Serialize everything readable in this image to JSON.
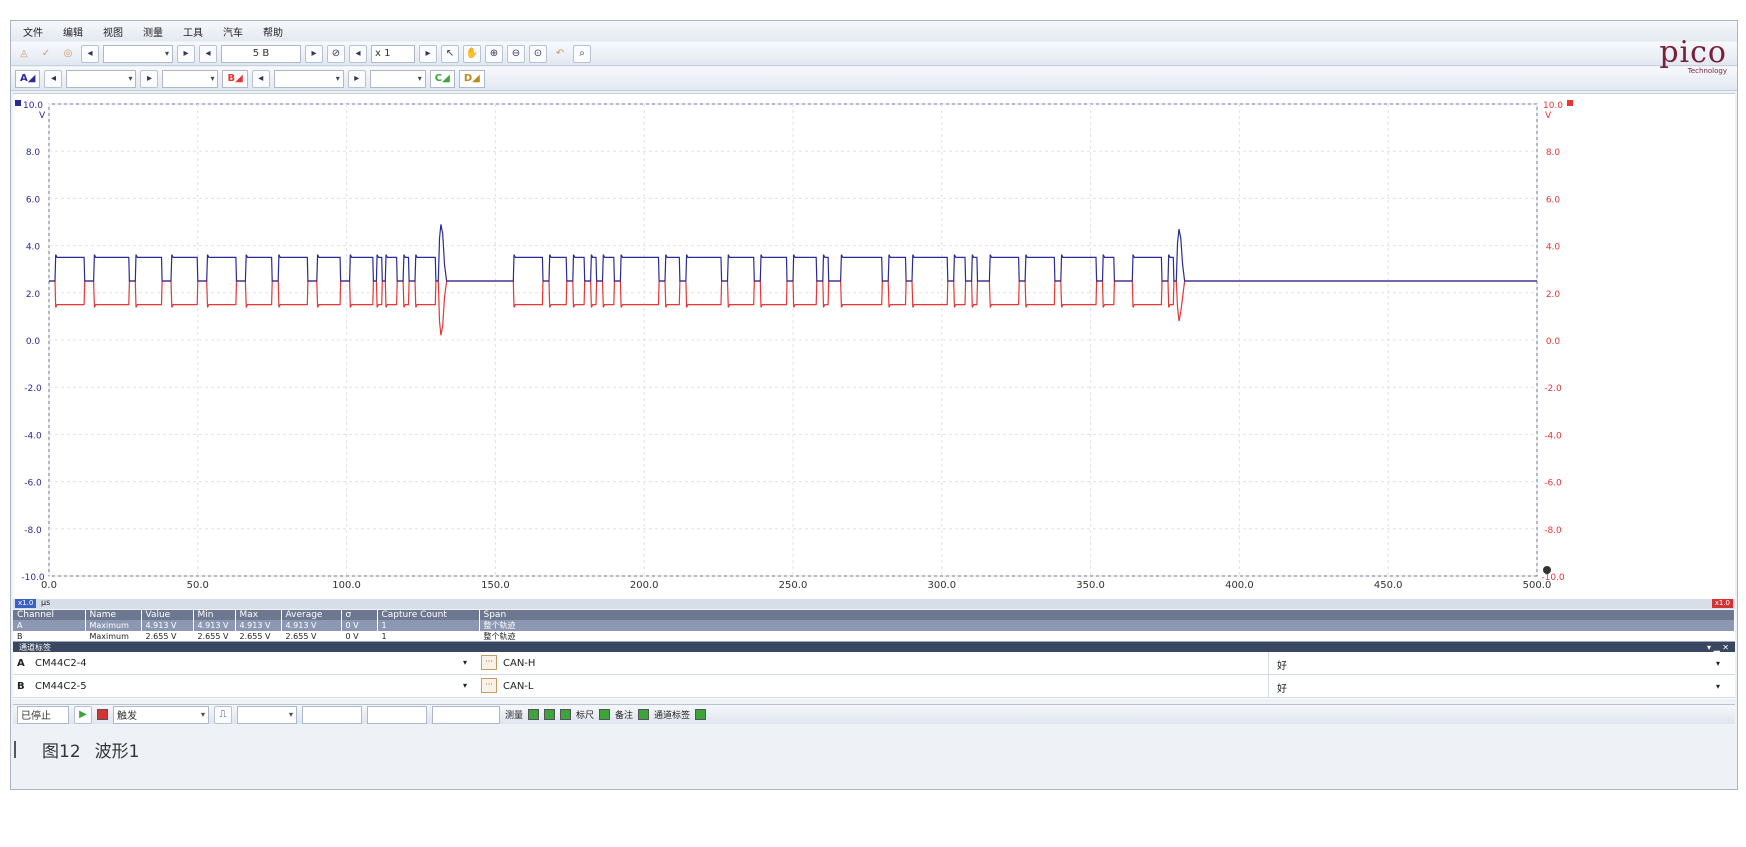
{
  "menu": [
    "文件",
    "编辑",
    "视图",
    "测量",
    "工具",
    "汽车",
    "帮助"
  ],
  "toolbar": {
    "samples_value": "5 B",
    "zoom_value": "x 1"
  },
  "channel_bar": {
    "channel_a": "A",
    "channel_b": "B",
    "channel_c": "C",
    "channel_d": "D"
  },
  "logo": {
    "brand": "pico",
    "sub": "Technology"
  },
  "colors": {
    "channel_a": "#2a2a9a",
    "channel_b": "#e83535",
    "grid": "#dfe3ea"
  },
  "chart_data": {
    "type": "line",
    "xlabel": "μs",
    "ylabel_left": "V",
    "ylabel_right": "V",
    "xlim": [
      0,
      500
    ],
    "ylim": [
      -10,
      10
    ],
    "x_ticks": [
      "0.0",
      "50.0",
      "100.0",
      "150.0",
      "200.0",
      "250.0",
      "300.0",
      "350.0",
      "400.0",
      "450.0",
      "500.0"
    ],
    "y_ticks": [
      "10.0",
      "8.0",
      "6.0",
      "4.0",
      "2.0",
      "0.0",
      "-2.0",
      "-4.0",
      "-6.0",
      "-8.0",
      "-10.0"
    ],
    "recessive_level": 2.5,
    "dominant_high": 3.5,
    "dominant_low": 1.5,
    "series": [
      {
        "name": "A",
        "color": "#2a2a9a"
      },
      {
        "name": "B",
        "color": "#e83535"
      }
    ],
    "frames": [
      {
        "start": 0,
        "end": 132,
        "pulses": [
          [
            2,
            12
          ],
          [
            15,
            27
          ],
          [
            29,
            38
          ],
          [
            41,
            50
          ],
          [
            53,
            63
          ],
          [
            66,
            75
          ],
          [
            77,
            87
          ],
          [
            90,
            98
          ],
          [
            101,
            109
          ],
          [
            110,
            112
          ],
          [
            113,
            117
          ],
          [
            119,
            121
          ],
          [
            123,
            130
          ]
        ],
        "ack_spike": [
          132,
          4.9,
          0.2
        ]
      },
      {
        "start": 156,
        "end": 381,
        "pulses": [
          [
            156,
            166
          ],
          [
            168,
            174
          ],
          [
            176,
            180
          ],
          [
            182,
            184
          ],
          [
            186,
            190
          ],
          [
            192,
            205
          ],
          [
            207,
            212
          ],
          [
            214,
            226
          ],
          [
            228,
            237
          ],
          [
            239,
            248
          ],
          [
            250,
            258
          ],
          [
            260,
            262
          ],
          [
            266,
            280
          ],
          [
            282,
            288
          ],
          [
            290,
            302
          ],
          [
            304,
            308
          ],
          [
            310,
            312
          ],
          [
            316,
            326
          ],
          [
            328,
            338
          ],
          [
            340,
            352
          ],
          [
            354,
            358
          ],
          [
            364,
            374
          ],
          [
            376,
            378
          ]
        ],
        "ack_spike": [
          380,
          4.7,
          0.8
        ]
      }
    ],
    "scale_a": "x1.0",
    "scale_b": "x1.0"
  },
  "measurements": {
    "headers": [
      "Channel",
      "Name",
      "Value",
      "Min",
      "Max",
      "Average",
      "σ",
      "Capture Count",
      "Span"
    ],
    "rows": [
      [
        "A",
        "Maximum",
        "4.913 V",
        "4.913 V",
        "4.913 V",
        "4.913 V",
        "0 V",
        "1",
        "整个轨迹"
      ],
      [
        "B",
        "Maximum",
        "2.655 V",
        "2.655 V",
        "2.655 V",
        "2.655 V",
        "0 V",
        "1",
        "整个轨迹"
      ]
    ]
  },
  "channel_labels": {
    "title": "通道标签",
    "rows": [
      {
        "ch": "A",
        "connector": "CM44C2-4",
        "signal": "CAN-H",
        "status": "好"
      },
      {
        "ch": "B",
        "connector": "CM44C2-5",
        "signal": "CAN-L",
        "status": "好"
      }
    ]
  },
  "statusbar": {
    "stop": "已停止",
    "trigger": "触发",
    "measure": "测量",
    "ruler": "标尺",
    "notes": "备注",
    "channel_labels": "通道标签"
  },
  "caption": {
    "figure": "图12",
    "title": "波形1"
  }
}
